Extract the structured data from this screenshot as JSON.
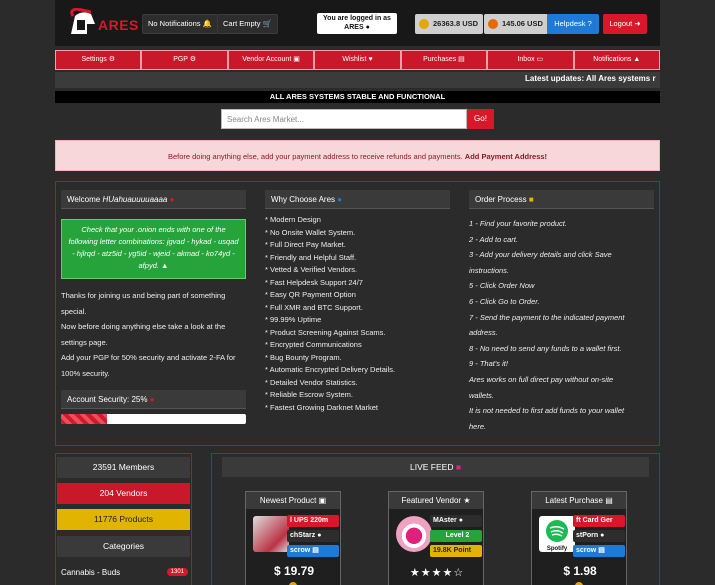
{
  "header": {
    "logo_text": "ARES",
    "notifications": "No Notifications",
    "cart": "Cart Empty",
    "login_line1": "You are logged in as",
    "login_line2": "ARES",
    "btc_balance": "26363.8 USD",
    "xmr_balance": "145.06 USD",
    "helpdesk": "Helpdesk",
    "logout": "Logout"
  },
  "nav": [
    {
      "label": "Settings",
      "icon": "users-cog-icon"
    },
    {
      "label": "PGP",
      "icon": "gear-icon"
    },
    {
      "label": "Vendor Account",
      "icon": "id-card-icon"
    },
    {
      "label": "Wishlist",
      "icon": "heart-icon"
    },
    {
      "label": "Purchases",
      "icon": "shopping-bag-icon"
    },
    {
      "label": "Inbox",
      "icon": "inbox-icon"
    },
    {
      "label": "Notifications",
      "icon": "warning-icon"
    }
  ],
  "ticker": "Latest updates: All Ares systems r",
  "status_bar": "ALL ARES SYSTEMS STABLE AND FUNCTIONAL",
  "search": {
    "placeholder": "Search Ares Market...",
    "button": "Go!"
  },
  "alert": {
    "text": "Before doing anything else, add your payment address to receive refunds and payments.",
    "link": "Add Payment Address!"
  },
  "welcome": {
    "title": "Welcome",
    "username": "HUahuauuuuaaaa",
    "onion_check": "Check that your .onion ends with one of the following letter combinations: jgvad - hykad - usqad - hjlrqd - atz5id - yg5id - wjeid - akmad - ko74yd - afpyd.",
    "thanks": "Thanks for joining us and being part of something special.",
    "settings_note": "Now before doing anything else take a look at the settings page.",
    "pgp_note": "Add your PGP for 50% security and activate 2-FA for 100% security.",
    "security_label": "Account Security: 25%",
    "security_pct": 25
  },
  "why": {
    "title": "Why Choose Ares",
    "items": [
      "* Modern Design",
      "* No Onsite Wallet System.",
      "* Full Direct Pay Market.",
      "* Friendly and Helpful Staff.",
      "* Vetted & Verified Vendors.",
      "* Fast Helpdesk Support 24/7",
      "* Easy QR Payment Option",
      "* Full XMR and BTC Support.",
      "* 99.99% Uptime",
      "* Product Screening Against Scams.",
      "* Encrypted Communications",
      "* Bug Bounty Program.",
      "* Automatic Encrypted Delivery Details.",
      "* Detailed Vendor Statistics.",
      "* Reliable Escrow System.",
      "* Fastest Growing Darknet Market"
    ]
  },
  "order": {
    "title": "Order Process",
    "steps": [
      "1 - Find your favorite product.",
      "2 - Add to cart.",
      "3 - Add your delivery details and click Save",
      "instructions.",
      "5 - Click Order Now",
      "6 - Click Go to Order.",
      "7 - Send the payment to the indicated payment",
      "address.",
      "8 - No need to send any funds to a wallet first.",
      "9 - That's it!",
      "Ares works on full direct pay without on-site",
      "wallets.",
      "It is not needed to first add funds to your wallet",
      "here."
    ]
  },
  "sidebar": {
    "members": "23591 Members",
    "vendors": "204 Vendors",
    "products": "11776 Products",
    "categories": "Categories",
    "first_category": "Cannabis - Buds",
    "first_category_count": "1301"
  },
  "feed": {
    "title": "LIVE FEED",
    "newest": {
      "title": "Newest Product",
      "tag1": "l UPS 220m",
      "tag2": "chStarz",
      "tag3": "scrow",
      "price": "$ 19.79"
    },
    "featured": {
      "title": "Featured Vendor",
      "tag1": "MAster",
      "tag2": "Level 2",
      "tag3": "19.8K Point"
    },
    "latest": {
      "title": "Latest Purchase",
      "tag1": "ft Card Ger",
      "tag2": "stPorn",
      "tag3": "scrow",
      "price": "$ 1.98",
      "thumb_label": "Spotify"
    }
  }
}
